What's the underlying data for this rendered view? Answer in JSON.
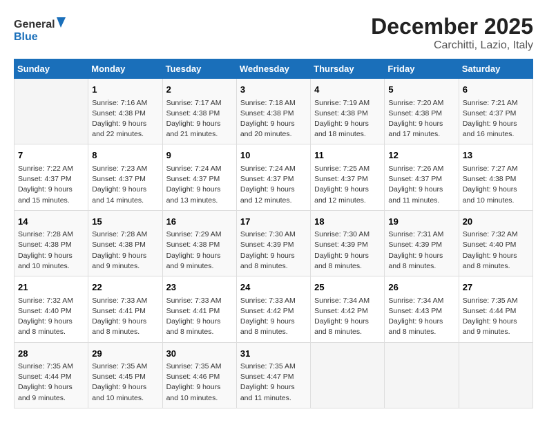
{
  "logo": {
    "line1": "General",
    "line2": "Blue"
  },
  "title": "December 2025",
  "location": "Carchitti, Lazio, Italy",
  "days_of_week": [
    "Sunday",
    "Monday",
    "Tuesday",
    "Wednesday",
    "Thursday",
    "Friday",
    "Saturday"
  ],
  "weeks": [
    [
      {
        "day": "",
        "sunrise": "",
        "sunset": "",
        "daylight": ""
      },
      {
        "day": "1",
        "sunrise": "Sunrise: 7:16 AM",
        "sunset": "Sunset: 4:38 PM",
        "daylight": "Daylight: 9 hours and 22 minutes."
      },
      {
        "day": "2",
        "sunrise": "Sunrise: 7:17 AM",
        "sunset": "Sunset: 4:38 PM",
        "daylight": "Daylight: 9 hours and 21 minutes."
      },
      {
        "day": "3",
        "sunrise": "Sunrise: 7:18 AM",
        "sunset": "Sunset: 4:38 PM",
        "daylight": "Daylight: 9 hours and 20 minutes."
      },
      {
        "day": "4",
        "sunrise": "Sunrise: 7:19 AM",
        "sunset": "Sunset: 4:38 PM",
        "daylight": "Daylight: 9 hours and 18 minutes."
      },
      {
        "day": "5",
        "sunrise": "Sunrise: 7:20 AM",
        "sunset": "Sunset: 4:38 PM",
        "daylight": "Daylight: 9 hours and 17 minutes."
      },
      {
        "day": "6",
        "sunrise": "Sunrise: 7:21 AM",
        "sunset": "Sunset: 4:37 PM",
        "daylight": "Daylight: 9 hours and 16 minutes."
      }
    ],
    [
      {
        "day": "7",
        "sunrise": "Sunrise: 7:22 AM",
        "sunset": "Sunset: 4:37 PM",
        "daylight": "Daylight: 9 hours and 15 minutes."
      },
      {
        "day": "8",
        "sunrise": "Sunrise: 7:23 AM",
        "sunset": "Sunset: 4:37 PM",
        "daylight": "Daylight: 9 hours and 14 minutes."
      },
      {
        "day": "9",
        "sunrise": "Sunrise: 7:24 AM",
        "sunset": "Sunset: 4:37 PM",
        "daylight": "Daylight: 9 hours and 13 minutes."
      },
      {
        "day": "10",
        "sunrise": "Sunrise: 7:24 AM",
        "sunset": "Sunset: 4:37 PM",
        "daylight": "Daylight: 9 hours and 12 minutes."
      },
      {
        "day": "11",
        "sunrise": "Sunrise: 7:25 AM",
        "sunset": "Sunset: 4:37 PM",
        "daylight": "Daylight: 9 hours and 12 minutes."
      },
      {
        "day": "12",
        "sunrise": "Sunrise: 7:26 AM",
        "sunset": "Sunset: 4:37 PM",
        "daylight": "Daylight: 9 hours and 11 minutes."
      },
      {
        "day": "13",
        "sunrise": "Sunrise: 7:27 AM",
        "sunset": "Sunset: 4:38 PM",
        "daylight": "Daylight: 9 hours and 10 minutes."
      }
    ],
    [
      {
        "day": "14",
        "sunrise": "Sunrise: 7:28 AM",
        "sunset": "Sunset: 4:38 PM",
        "daylight": "Daylight: 9 hours and 10 minutes."
      },
      {
        "day": "15",
        "sunrise": "Sunrise: 7:28 AM",
        "sunset": "Sunset: 4:38 PM",
        "daylight": "Daylight: 9 hours and 9 minutes."
      },
      {
        "day": "16",
        "sunrise": "Sunrise: 7:29 AM",
        "sunset": "Sunset: 4:38 PM",
        "daylight": "Daylight: 9 hours and 9 minutes."
      },
      {
        "day": "17",
        "sunrise": "Sunrise: 7:30 AM",
        "sunset": "Sunset: 4:39 PM",
        "daylight": "Daylight: 9 hours and 8 minutes."
      },
      {
        "day": "18",
        "sunrise": "Sunrise: 7:30 AM",
        "sunset": "Sunset: 4:39 PM",
        "daylight": "Daylight: 9 hours and 8 minutes."
      },
      {
        "day": "19",
        "sunrise": "Sunrise: 7:31 AM",
        "sunset": "Sunset: 4:39 PM",
        "daylight": "Daylight: 9 hours and 8 minutes."
      },
      {
        "day": "20",
        "sunrise": "Sunrise: 7:32 AM",
        "sunset": "Sunset: 4:40 PM",
        "daylight": "Daylight: 9 hours and 8 minutes."
      }
    ],
    [
      {
        "day": "21",
        "sunrise": "Sunrise: 7:32 AM",
        "sunset": "Sunset: 4:40 PM",
        "daylight": "Daylight: 9 hours and 8 minutes."
      },
      {
        "day": "22",
        "sunrise": "Sunrise: 7:33 AM",
        "sunset": "Sunset: 4:41 PM",
        "daylight": "Daylight: 9 hours and 8 minutes."
      },
      {
        "day": "23",
        "sunrise": "Sunrise: 7:33 AM",
        "sunset": "Sunset: 4:41 PM",
        "daylight": "Daylight: 9 hours and 8 minutes."
      },
      {
        "day": "24",
        "sunrise": "Sunrise: 7:33 AM",
        "sunset": "Sunset: 4:42 PM",
        "daylight": "Daylight: 9 hours and 8 minutes."
      },
      {
        "day": "25",
        "sunrise": "Sunrise: 7:34 AM",
        "sunset": "Sunset: 4:42 PM",
        "daylight": "Daylight: 9 hours and 8 minutes."
      },
      {
        "day": "26",
        "sunrise": "Sunrise: 7:34 AM",
        "sunset": "Sunset: 4:43 PM",
        "daylight": "Daylight: 9 hours and 8 minutes."
      },
      {
        "day": "27",
        "sunrise": "Sunrise: 7:35 AM",
        "sunset": "Sunset: 4:44 PM",
        "daylight": "Daylight: 9 hours and 9 minutes."
      }
    ],
    [
      {
        "day": "28",
        "sunrise": "Sunrise: 7:35 AM",
        "sunset": "Sunset: 4:44 PM",
        "daylight": "Daylight: 9 hours and 9 minutes."
      },
      {
        "day": "29",
        "sunrise": "Sunrise: 7:35 AM",
        "sunset": "Sunset: 4:45 PM",
        "daylight": "Daylight: 9 hours and 10 minutes."
      },
      {
        "day": "30",
        "sunrise": "Sunrise: 7:35 AM",
        "sunset": "Sunset: 4:46 PM",
        "daylight": "Daylight: 9 hours and 10 minutes."
      },
      {
        "day": "31",
        "sunrise": "Sunrise: 7:35 AM",
        "sunset": "Sunset: 4:47 PM",
        "daylight": "Daylight: 9 hours and 11 minutes."
      },
      {
        "day": "",
        "sunrise": "",
        "sunset": "",
        "daylight": ""
      },
      {
        "day": "",
        "sunrise": "",
        "sunset": "",
        "daylight": ""
      },
      {
        "day": "",
        "sunrise": "",
        "sunset": "",
        "daylight": ""
      }
    ]
  ]
}
